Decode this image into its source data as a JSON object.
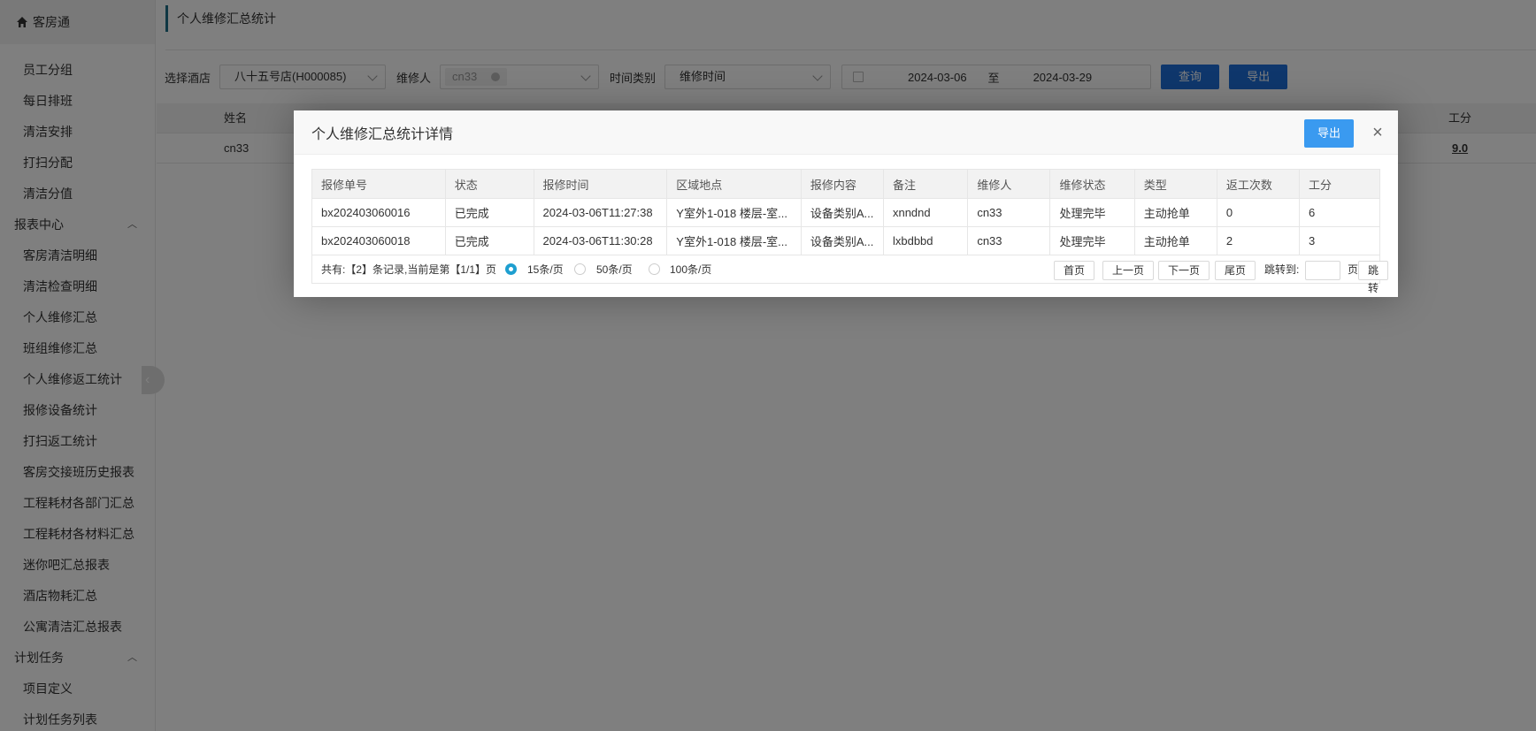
{
  "brand": {
    "title": "客房通",
    "icon": "home-icon"
  },
  "sidebar": {
    "items": [
      {
        "label": "员工分组",
        "type": "sub"
      },
      {
        "label": "每日排班",
        "type": "sub"
      },
      {
        "label": "清洁安排",
        "type": "sub"
      },
      {
        "label": "打扫分配",
        "type": "sub"
      },
      {
        "label": "清洁分值",
        "type": "sub"
      },
      {
        "label": "报表中心",
        "type": "group"
      },
      {
        "label": "客房清洁明细",
        "type": "sub"
      },
      {
        "label": "清洁检查明细",
        "type": "sub"
      },
      {
        "label": "个人维修汇总",
        "type": "sub"
      },
      {
        "label": "班组维修汇总",
        "type": "sub"
      },
      {
        "label": "个人维修返工统计",
        "type": "sub"
      },
      {
        "label": "报修设备统计",
        "type": "sub"
      },
      {
        "label": "打扫返工统计",
        "type": "sub"
      },
      {
        "label": "客房交接班历史报表",
        "type": "sub"
      },
      {
        "label": "工程耗材各部门汇总",
        "type": "sub"
      },
      {
        "label": "工程耗材各材料汇总",
        "type": "sub"
      },
      {
        "label": "迷你吧汇总报表",
        "type": "sub"
      },
      {
        "label": "酒店物耗汇总",
        "type": "sub"
      },
      {
        "label": "公寓清洁汇总报表",
        "type": "sub"
      },
      {
        "label": "计划任务",
        "type": "group"
      },
      {
        "label": "项目定义",
        "type": "sub"
      },
      {
        "label": "计划任务列表",
        "type": "sub"
      }
    ]
  },
  "page": {
    "title": "个人维修汇总统计",
    "filters": {
      "hotel_label": "选择酒店",
      "hotel_value": "八十五号店(H000085)",
      "repairer_label": "维修人",
      "repairer_tag": "cn33",
      "time_type_label": "时间类别",
      "time_type_value": "维修时间",
      "date_start": "2024-03-06",
      "date_sep": "至",
      "date_end": "2024-03-29",
      "query_label": "查询",
      "export_label": "导出"
    },
    "grid": {
      "headers": {
        "name": "姓名",
        "score": "工分"
      },
      "row": {
        "name": "cn33",
        "score": "9.0"
      }
    }
  },
  "dialog": {
    "title": "个人维修汇总统计详情",
    "export_label": "导出",
    "close_glyph": "×",
    "columns": [
      "报修单号",
      "状态",
      "报修时间",
      "区域地点",
      "报修内容",
      "备注",
      "维修人",
      "维修状态",
      "类型",
      "返工次数",
      "工分"
    ],
    "rows": [
      [
        "bx202403060016",
        "已完成",
        "2024-03-06T11:27:38",
        "Y室外1-018 楼层-室...",
        "设备类别A...",
        "xnndnd",
        "cn33",
        "处理完毕",
        "主动抢单",
        "0",
        "6"
      ],
      [
        "bx202403060018",
        "已完成",
        "2024-03-06T11:30:28",
        "Y室外1-018 楼层-室...",
        "设备类别A...",
        "lxbdbbd",
        "cn33",
        "处理完毕",
        "主动抢单",
        "2",
        "3"
      ]
    ],
    "pager": {
      "info": "共有:【2】条记录,当前是第【1/1】页",
      "size_15": "15条/页",
      "size_50": "50条/页",
      "size_100": "100条/页",
      "first": "首页",
      "prev": "上一页",
      "next": "下一页",
      "last": "尾页",
      "jump_label": "跳转到:",
      "page_unit": "页",
      "jump_button": "跳转"
    }
  }
}
